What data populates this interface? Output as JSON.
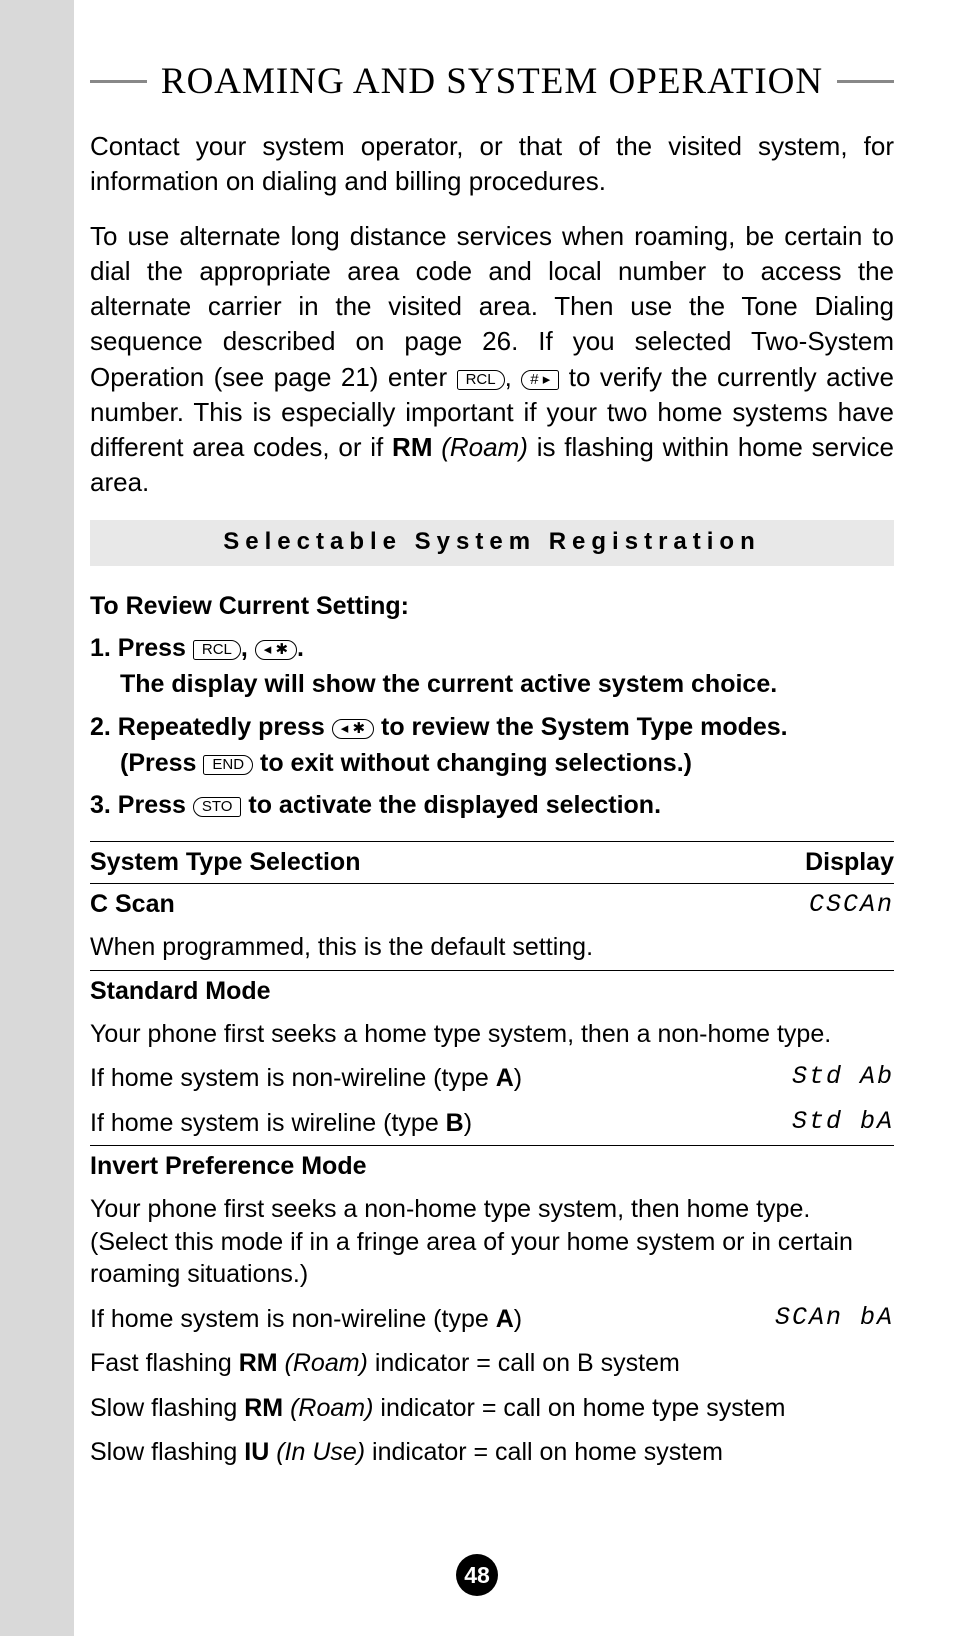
{
  "header": {
    "title": "ROAMING AND SYSTEM OPERATION"
  },
  "intro": {
    "p1": "Contact your system operator, or that of the visited system, for information on dialing and billing procedures.",
    "p2a": "To use alternate long distance services when roaming, be certain to dial the appropriate area code and local number to access the alternate carrier in the visited area. Then use the Tone Dialing sequence described on page 26. If you selected Two-System Operation (see page 21) enter ",
    "p2b": ", ",
    "p2c": " to verify the currently active number. This is especially important if your two home systems have different area codes, or if ",
    "rm": "RM",
    "roam": "(Roam)",
    "p2d": " is flashing within home service area."
  },
  "keys": {
    "rcl": "RCL",
    "hash": "# ▸",
    "star": "◂ ✱",
    "end": "END",
    "sto": "STO"
  },
  "section": {
    "band": "Selectable System Registration"
  },
  "steps": {
    "review_heading": "To Review Current Setting:",
    "s1a": "1. Press ",
    "s1b": ", ",
    "s1c": ".",
    "s1_sub": "The display will show the current active system choice.",
    "s2a": "2. Repeatedly press ",
    "s2b": " to review the System Type modes.",
    "s2_suba": "(Press ",
    "s2_subb": " to exit without changing selections.)",
    "s3a": "3. Press ",
    "s3b": " to activate the displayed selection."
  },
  "table": {
    "h1": "System Type Selection",
    "h2": "Display",
    "cscan": {
      "name": "C Scan",
      "disp": "CSCAn",
      "desc": "When programmed, this is the default setting."
    },
    "std": {
      "name": "Standard Mode",
      "desc": "Your phone first seeks a home type system, then a non-home type.",
      "rowA_a": "If home system is non-wireline (type ",
      "rowA_b": "A",
      "rowA_c": ")",
      "rowA_disp": "Std Ab",
      "rowB_a": "If home system is wireline (type ",
      "rowB_b": "B",
      "rowB_c": ")",
      "rowB_disp": "Std bA"
    },
    "inv": {
      "name": "Invert Preference Mode",
      "desc": "Your phone first seeks a non-home type system, then home type. (Select this mode if in a fringe area of your home system or in certain roaming situations.)",
      "rowA_a": "If home system is non-wireline (type ",
      "rowA_b": "A",
      "rowA_c": ")",
      "rowA_disp": "SCAn bA",
      "fast_a": "Fast flashing ",
      "rm": "RM",
      "roam": "(Roam)",
      "fast_b": " indicator = call on B system",
      "slow1_a": "Slow flashing ",
      "slow1_b": " indicator = call on home type system",
      "slow2_a": "Slow flashing ",
      "iu": "IU",
      "inuse": "(In Use)",
      "slow2_b": " indicator = call on home system"
    }
  },
  "page": {
    "num": "48"
  }
}
